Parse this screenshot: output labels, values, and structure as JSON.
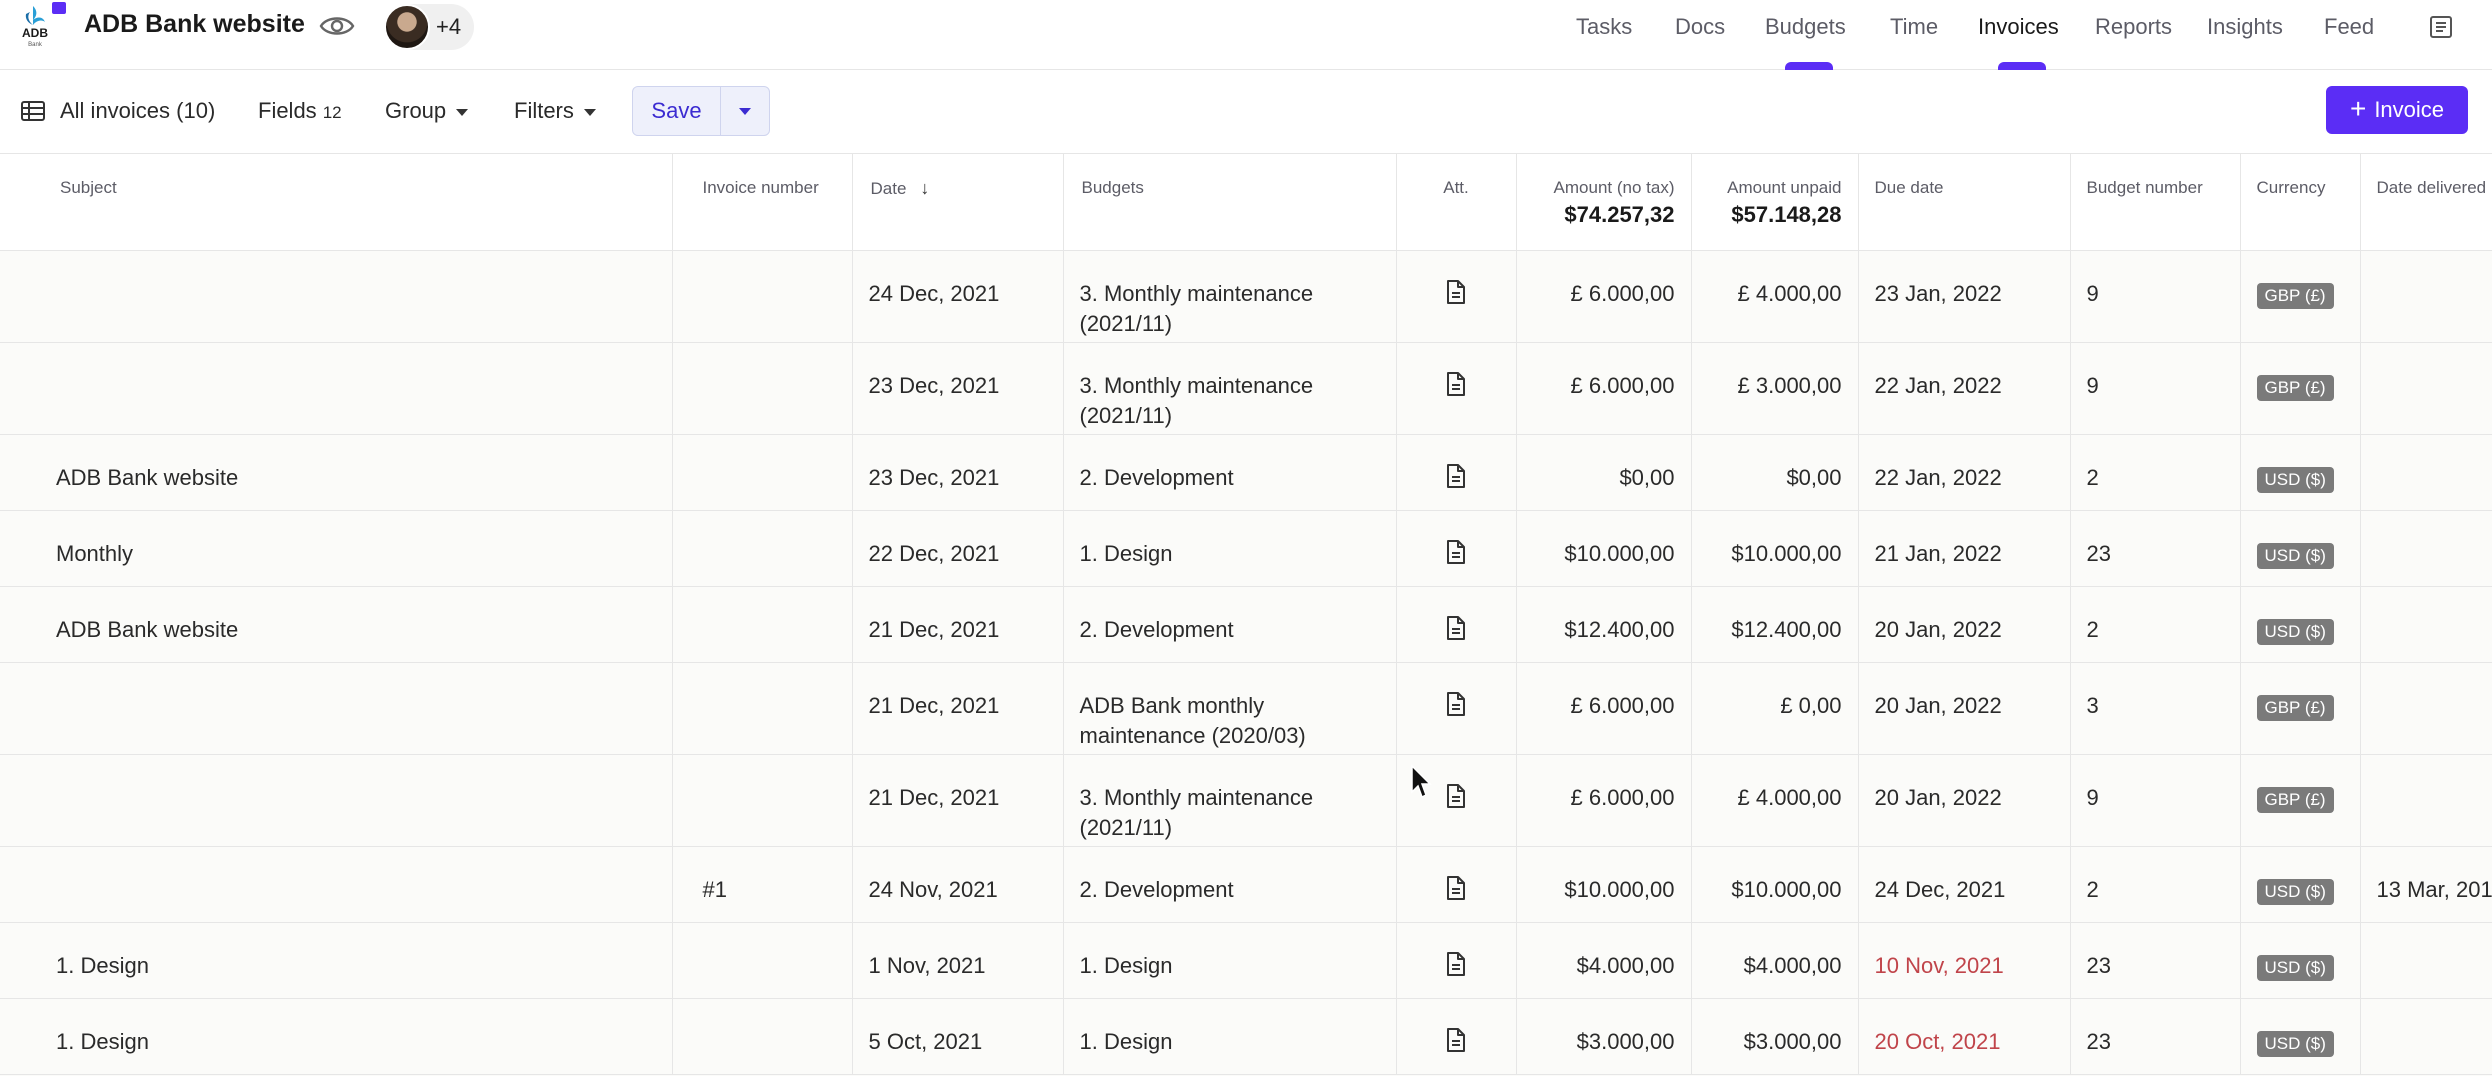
{
  "header": {
    "logo_text": "ADB",
    "logo_sub": "Bank",
    "project_title": "ADB Bank website",
    "avatar_more": "+4",
    "tabs": [
      {
        "label": "Tasks",
        "active": false
      },
      {
        "label": "Docs",
        "active": false
      },
      {
        "label": "Budgets",
        "active": false
      },
      {
        "label": "Time",
        "active": false
      },
      {
        "label": "Invoices",
        "active": true
      },
      {
        "label": "Reports",
        "active": false
      },
      {
        "label": "Insights",
        "active": false
      },
      {
        "label": "Feed",
        "active": false
      }
    ]
  },
  "toolbar": {
    "view_label": "All invoices (10)",
    "fields_label": "Fields",
    "fields_count": "12",
    "group_label": "Group",
    "filters_label": "Filters",
    "save_label": "Save",
    "new_invoice_label": "Invoice"
  },
  "table": {
    "columns": {
      "subject": "Subject",
      "invoice_number": "Invoice number",
      "date": "Date",
      "budgets": "Budgets",
      "att": "Att.",
      "amount_no_tax": "Amount (no tax)",
      "amount_no_tax_total": "$74.257,32",
      "amount_unpaid": "Amount unpaid",
      "amount_unpaid_total": "$57.148,28",
      "due_date": "Due date",
      "budget_number": "Budget number",
      "currency": "Currency",
      "date_delivered": "Date delivered"
    },
    "rows": [
      {
        "subject": "",
        "invoice_number": "",
        "date": "24 Dec, 2021",
        "budget": "3. Monthly maintenance (2021/11)",
        "amount": "£ 6.000,00",
        "unpaid": "£ 4.000,00",
        "due": "23 Jan, 2022",
        "overdue": false,
        "budget_number": "9",
        "currency": "GBP (£)",
        "delivered": ""
      },
      {
        "subject": "",
        "invoice_number": "",
        "date": "23 Dec, 2021",
        "budget": "3. Monthly maintenance (2021/11)",
        "amount": "£ 6.000,00",
        "unpaid": "£ 3.000,00",
        "due": "22 Jan, 2022",
        "overdue": false,
        "budget_number": "9",
        "currency": "GBP (£)",
        "delivered": ""
      },
      {
        "subject": "ADB Bank website",
        "invoice_number": "",
        "date": "23 Dec, 2021",
        "budget": "2. Development",
        "amount": "$0,00",
        "unpaid": "$0,00",
        "due": "22 Jan, 2022",
        "overdue": false,
        "budget_number": "2",
        "currency": "USD ($)",
        "delivered": ""
      },
      {
        "subject": "Monthly",
        "invoice_number": "",
        "date": "22 Dec, 2021",
        "budget": "1. Design",
        "amount": "$10.000,00",
        "unpaid": "$10.000,00",
        "due": "21 Jan, 2022",
        "overdue": false,
        "budget_number": "23",
        "currency": "USD ($)",
        "delivered": ""
      },
      {
        "subject": "ADB Bank website",
        "invoice_number": "",
        "date": "21 Dec, 2021",
        "budget": "2. Development",
        "amount": "$12.400,00",
        "unpaid": "$12.400,00",
        "due": "20 Jan, 2022",
        "overdue": false,
        "budget_number": "2",
        "currency": "USD ($)",
        "delivered": ""
      },
      {
        "subject": "",
        "invoice_number": "",
        "date": "21 Dec, 2021",
        "budget": "ADB Bank monthly maintenance (2020/03)",
        "amount": "£ 6.000,00",
        "unpaid": "£ 0,00",
        "due": "20 Jan, 2022",
        "overdue": false,
        "budget_number": "3",
        "currency": "GBP (£)",
        "delivered": ""
      },
      {
        "subject": "",
        "invoice_number": "",
        "date": "21 Dec, 2021",
        "budget": "3. Monthly maintenance (2021/11)",
        "amount": "£ 6.000,00",
        "unpaid": "£ 4.000,00",
        "due": "20 Jan, 2022",
        "overdue": false,
        "budget_number": "9",
        "currency": "GBP (£)",
        "delivered": ""
      },
      {
        "subject": "",
        "invoice_number": "#1",
        "date": "24 Nov, 2021",
        "budget": "2. Development",
        "amount": "$10.000,00",
        "unpaid": "$10.000,00",
        "due": "24 Dec, 2021",
        "overdue": false,
        "budget_number": "2",
        "currency": "USD ($)",
        "delivered": "13 Mar, 201"
      },
      {
        "subject": "1. Design",
        "invoice_number": "",
        "date": "1 Nov, 2021",
        "budget": "1. Design",
        "amount": "$4.000,00",
        "unpaid": "$4.000,00",
        "due": "10 Nov, 2021",
        "overdue": true,
        "budget_number": "23",
        "currency": "USD ($)",
        "delivered": ""
      },
      {
        "subject": "1. Design",
        "invoice_number": "",
        "date": "5 Oct, 2021",
        "budget": "1. Design",
        "amount": "$3.000,00",
        "unpaid": "$3.000,00",
        "due": "20 Oct, 2021",
        "overdue": true,
        "budget_number": "23",
        "currency": "USD ($)",
        "delivered": ""
      }
    ]
  },
  "colors": {
    "accent": "#5b2df5",
    "overdue": "#c0444a",
    "badge": "#7a7a7a"
  }
}
